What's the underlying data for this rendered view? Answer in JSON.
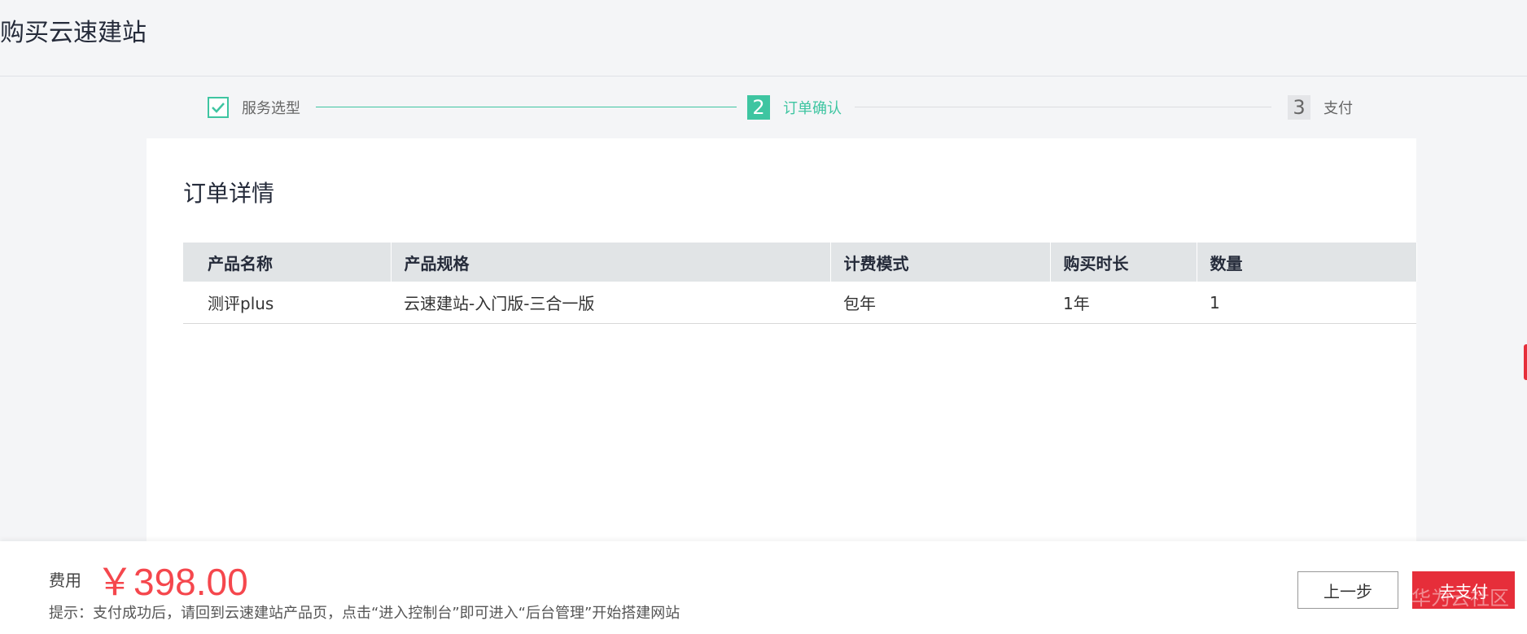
{
  "header": {
    "title": "购买云速建站"
  },
  "steps": [
    {
      "number": "",
      "label": "服务选型",
      "state": "done"
    },
    {
      "number": "2",
      "label": "订单确认",
      "state": "active"
    },
    {
      "number": "3",
      "label": "支付",
      "state": "pending"
    }
  ],
  "order": {
    "title": "订单详情",
    "columns": [
      "产品名称",
      "产品规格",
      "计费模式",
      "购买时长",
      "数量"
    ],
    "rows": [
      [
        "测评plus",
        "云速建站-入门版-三合一版",
        "包年",
        "1年",
        "1"
      ]
    ]
  },
  "footer": {
    "fee_label": "费用",
    "fee_amount": "￥398.00",
    "tip": "提示：支付成功后，请回到云速建站产品页，点击“进入控制台”即可进入“后台管理”开始搭建网站",
    "prev_label": "上一步",
    "pay_label": "去支付",
    "watermark": "华为云社区"
  },
  "colors": {
    "accent": "#3ec5a1",
    "price": "#f5474d",
    "pay_button": "#e62e3a"
  }
}
